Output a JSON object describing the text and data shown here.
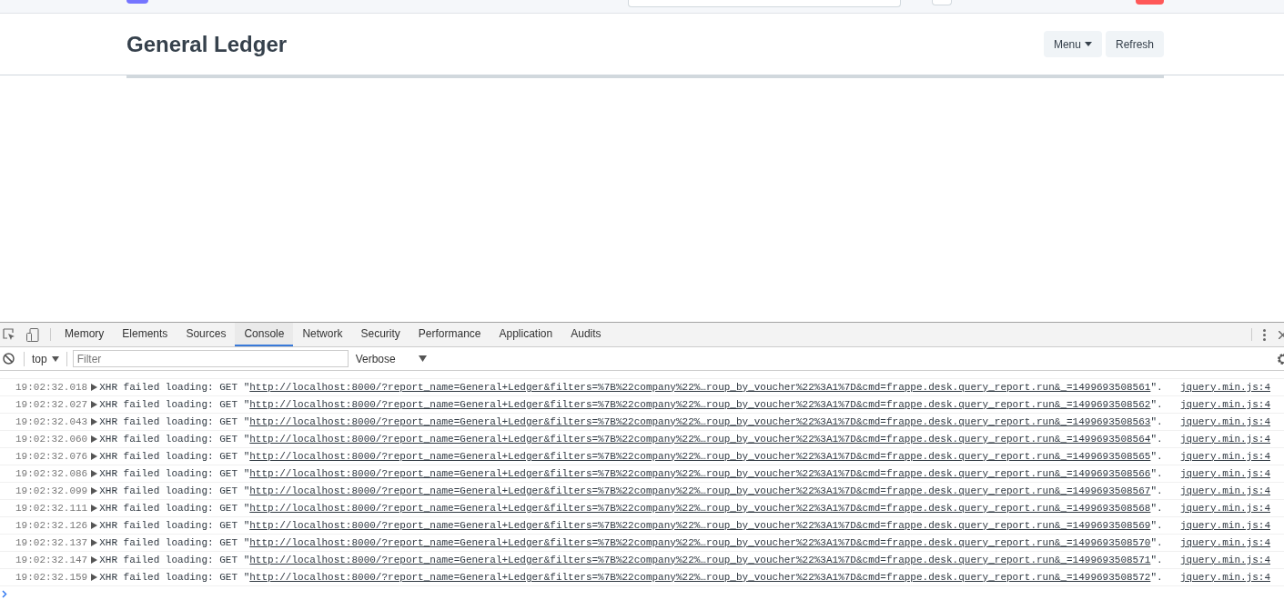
{
  "page": {
    "title": "General Ledger",
    "buttons": [
      {
        "label": "Menu",
        "kind": "dropdown"
      },
      {
        "label": "Refresh",
        "kind": "plain"
      }
    ]
  },
  "devtools": {
    "tabs": [
      {
        "label": "Memory",
        "selected": false
      },
      {
        "label": "Elements",
        "selected": false
      },
      {
        "label": "Sources",
        "selected": false
      },
      {
        "label": "Console",
        "selected": true
      },
      {
        "label": "Network",
        "selected": false
      },
      {
        "label": "Security",
        "selected": false
      },
      {
        "label": "Performance",
        "selected": false
      },
      {
        "label": "Application",
        "selected": false
      },
      {
        "label": "Audits",
        "selected": false
      }
    ],
    "context": "top",
    "filter": {
      "placeholder": "Filter"
    },
    "level": "Verbose",
    "log": [
      {
        "time": "19:02:32.018",
        "prefix": "XHR failed loading: GET \"",
        "url": "http://localhost:8000/?report_name=General+Ledger&filters=%7B%22company%22%…roup_by_voucher%22%3A1%7D&cmd=frappe.desk.query_report.run&_=1499693508561",
        "suffix": "\".",
        "source": "jquery.min.js:4"
      },
      {
        "time": "19:02:32.027",
        "prefix": "XHR failed loading: GET \"",
        "url": "http://localhost:8000/?report_name=General+Ledger&filters=%7B%22company%22%…roup_by_voucher%22%3A1%7D&cmd=frappe.desk.query_report.run&_=1499693508562",
        "suffix": "\".",
        "source": "jquery.min.js:4"
      },
      {
        "time": "19:02:32.043",
        "prefix": "XHR failed loading: GET \"",
        "url": "http://localhost:8000/?report_name=General+Ledger&filters=%7B%22company%22%…roup_by_voucher%22%3A1%7D&cmd=frappe.desk.query_report.run&_=1499693508563",
        "suffix": "\".",
        "source": "jquery.min.js:4"
      },
      {
        "time": "19:02:32.060",
        "prefix": "XHR failed loading: GET \"",
        "url": "http://localhost:8000/?report_name=General+Ledger&filters=%7B%22company%22%…roup_by_voucher%22%3A1%7D&cmd=frappe.desk.query_report.run&_=1499693508564",
        "suffix": "\".",
        "source": "jquery.min.js:4"
      },
      {
        "time": "19:02:32.076",
        "prefix": "XHR failed loading: GET \"",
        "url": "http://localhost:8000/?report_name=General+Ledger&filters=%7B%22company%22%…roup_by_voucher%22%3A1%7D&cmd=frappe.desk.query_report.run&_=1499693508565",
        "suffix": "\".",
        "source": "jquery.min.js:4"
      },
      {
        "time": "19:02:32.086",
        "prefix": "XHR failed loading: GET \"",
        "url": "http://localhost:8000/?report_name=General+Ledger&filters=%7B%22company%22%…roup_by_voucher%22%3A1%7D&cmd=frappe.desk.query_report.run&_=1499693508566",
        "suffix": "\".",
        "source": "jquery.min.js:4"
      },
      {
        "time": "19:02:32.099",
        "prefix": "XHR failed loading: GET \"",
        "url": "http://localhost:8000/?report_name=General+Ledger&filters=%7B%22company%22%…roup_by_voucher%22%3A1%7D&cmd=frappe.desk.query_report.run&_=1499693508567",
        "suffix": "\".",
        "source": "jquery.min.js:4"
      },
      {
        "time": "19:02:32.111",
        "prefix": "XHR failed loading: GET \"",
        "url": "http://localhost:8000/?report_name=General+Ledger&filters=%7B%22company%22%…roup_by_voucher%22%3A1%7D&cmd=frappe.desk.query_report.run&_=1499693508568",
        "suffix": "\".",
        "source": "jquery.min.js:4"
      },
      {
        "time": "19:02:32.126",
        "prefix": "XHR failed loading: GET \"",
        "url": "http://localhost:8000/?report_name=General+Ledger&filters=%7B%22company%22%…roup_by_voucher%22%3A1%7D&cmd=frappe.desk.query_report.run&_=1499693508569",
        "suffix": "\".",
        "source": "jquery.min.js:4"
      },
      {
        "time": "19:02:32.137",
        "prefix": "XHR failed loading: GET \"",
        "url": "http://localhost:8000/?report_name=General+Ledger&filters=%7B%22company%22%…roup_by_voucher%22%3A1%7D&cmd=frappe.desk.query_report.run&_=1499693508570",
        "suffix": "\".",
        "source": "jquery.min.js:4"
      },
      {
        "time": "19:02:32.147",
        "prefix": "XHR failed loading: GET \"",
        "url": "http://localhost:8000/?report_name=General+Ledger&filters=%7B%22company%22%…roup_by_voucher%22%3A1%7D&cmd=frappe.desk.query_report.run&_=1499693508571",
        "suffix": "\".",
        "source": "jquery.min.js:4"
      },
      {
        "time": "19:02:32.159",
        "prefix": "XHR failed loading: GET \"",
        "url": "http://localhost:8000/?report_name=General+Ledger&filters=%7B%22company%22%…roup_by_voucher%22%3A1%7D&cmd=frappe.desk.query_report.run&_=1499693508572",
        "suffix": "\".",
        "source": "jquery.min.js:4"
      }
    ]
  }
}
